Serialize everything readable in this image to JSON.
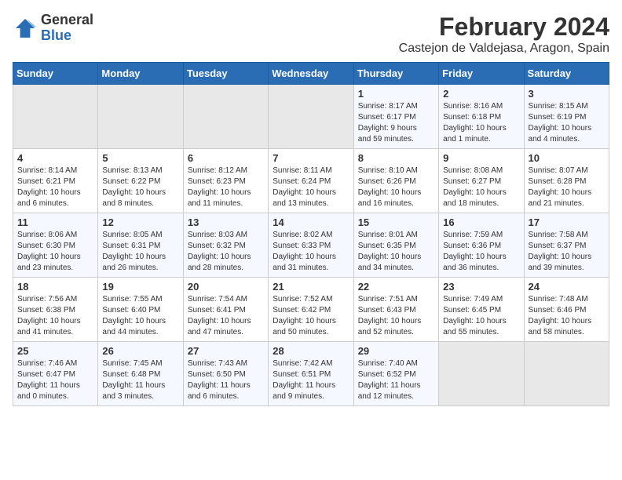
{
  "logo": {
    "general": "General",
    "blue": "Blue"
  },
  "title": "February 2024",
  "subtitle": "Castejon de Valdejasa, Aragon, Spain",
  "weekdays": [
    "Sunday",
    "Monday",
    "Tuesday",
    "Wednesday",
    "Thursday",
    "Friday",
    "Saturday"
  ],
  "weeks": [
    [
      {
        "day": "",
        "info": ""
      },
      {
        "day": "",
        "info": ""
      },
      {
        "day": "",
        "info": ""
      },
      {
        "day": "",
        "info": ""
      },
      {
        "day": "1",
        "info": "Sunrise: 8:17 AM\nSunset: 6:17 PM\nDaylight: 9 hours\nand 59 minutes."
      },
      {
        "day": "2",
        "info": "Sunrise: 8:16 AM\nSunset: 6:18 PM\nDaylight: 10 hours\nand 1 minute."
      },
      {
        "day": "3",
        "info": "Sunrise: 8:15 AM\nSunset: 6:19 PM\nDaylight: 10 hours\nand 4 minutes."
      }
    ],
    [
      {
        "day": "4",
        "info": "Sunrise: 8:14 AM\nSunset: 6:21 PM\nDaylight: 10 hours\nand 6 minutes."
      },
      {
        "day": "5",
        "info": "Sunrise: 8:13 AM\nSunset: 6:22 PM\nDaylight: 10 hours\nand 8 minutes."
      },
      {
        "day": "6",
        "info": "Sunrise: 8:12 AM\nSunset: 6:23 PM\nDaylight: 10 hours\nand 11 minutes."
      },
      {
        "day": "7",
        "info": "Sunrise: 8:11 AM\nSunset: 6:24 PM\nDaylight: 10 hours\nand 13 minutes."
      },
      {
        "day": "8",
        "info": "Sunrise: 8:10 AM\nSunset: 6:26 PM\nDaylight: 10 hours\nand 16 minutes."
      },
      {
        "day": "9",
        "info": "Sunrise: 8:08 AM\nSunset: 6:27 PM\nDaylight: 10 hours\nand 18 minutes."
      },
      {
        "day": "10",
        "info": "Sunrise: 8:07 AM\nSunset: 6:28 PM\nDaylight: 10 hours\nand 21 minutes."
      }
    ],
    [
      {
        "day": "11",
        "info": "Sunrise: 8:06 AM\nSunset: 6:30 PM\nDaylight: 10 hours\nand 23 minutes."
      },
      {
        "day": "12",
        "info": "Sunrise: 8:05 AM\nSunset: 6:31 PM\nDaylight: 10 hours\nand 26 minutes."
      },
      {
        "day": "13",
        "info": "Sunrise: 8:03 AM\nSunset: 6:32 PM\nDaylight: 10 hours\nand 28 minutes."
      },
      {
        "day": "14",
        "info": "Sunrise: 8:02 AM\nSunset: 6:33 PM\nDaylight: 10 hours\nand 31 minutes."
      },
      {
        "day": "15",
        "info": "Sunrise: 8:01 AM\nSunset: 6:35 PM\nDaylight: 10 hours\nand 34 minutes."
      },
      {
        "day": "16",
        "info": "Sunrise: 7:59 AM\nSunset: 6:36 PM\nDaylight: 10 hours\nand 36 minutes."
      },
      {
        "day": "17",
        "info": "Sunrise: 7:58 AM\nSunset: 6:37 PM\nDaylight: 10 hours\nand 39 minutes."
      }
    ],
    [
      {
        "day": "18",
        "info": "Sunrise: 7:56 AM\nSunset: 6:38 PM\nDaylight: 10 hours\nand 41 minutes."
      },
      {
        "day": "19",
        "info": "Sunrise: 7:55 AM\nSunset: 6:40 PM\nDaylight: 10 hours\nand 44 minutes."
      },
      {
        "day": "20",
        "info": "Sunrise: 7:54 AM\nSunset: 6:41 PM\nDaylight: 10 hours\nand 47 minutes."
      },
      {
        "day": "21",
        "info": "Sunrise: 7:52 AM\nSunset: 6:42 PM\nDaylight: 10 hours\nand 50 minutes."
      },
      {
        "day": "22",
        "info": "Sunrise: 7:51 AM\nSunset: 6:43 PM\nDaylight: 10 hours\nand 52 minutes."
      },
      {
        "day": "23",
        "info": "Sunrise: 7:49 AM\nSunset: 6:45 PM\nDaylight: 10 hours\nand 55 minutes."
      },
      {
        "day": "24",
        "info": "Sunrise: 7:48 AM\nSunset: 6:46 PM\nDaylight: 10 hours\nand 58 minutes."
      }
    ],
    [
      {
        "day": "25",
        "info": "Sunrise: 7:46 AM\nSunset: 6:47 PM\nDaylight: 11 hours\nand 0 minutes."
      },
      {
        "day": "26",
        "info": "Sunrise: 7:45 AM\nSunset: 6:48 PM\nDaylight: 11 hours\nand 3 minutes."
      },
      {
        "day": "27",
        "info": "Sunrise: 7:43 AM\nSunset: 6:50 PM\nDaylight: 11 hours\nand 6 minutes."
      },
      {
        "day": "28",
        "info": "Sunrise: 7:42 AM\nSunset: 6:51 PM\nDaylight: 11 hours\nand 9 minutes."
      },
      {
        "day": "29",
        "info": "Sunrise: 7:40 AM\nSunset: 6:52 PM\nDaylight: 11 hours\nand 12 minutes."
      },
      {
        "day": "",
        "info": ""
      },
      {
        "day": "",
        "info": ""
      }
    ]
  ]
}
